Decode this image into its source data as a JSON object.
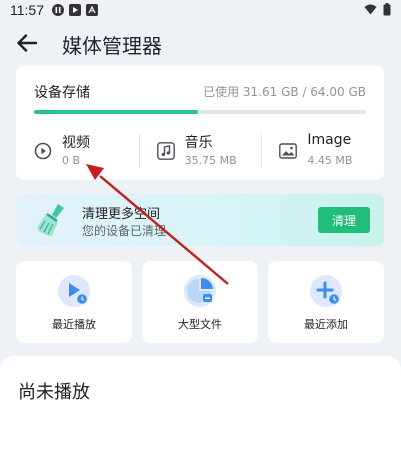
{
  "status_bar": {
    "time": "11:57",
    "icons": [
      "pause-icon",
      "play-store-icon",
      "a-badge-icon",
      "wifi-icon",
      "battery-icon"
    ]
  },
  "header": {
    "title": "媒体管理器",
    "back_icon": "arrow-back-icon"
  },
  "storage": {
    "title": "设备存储",
    "used_text": "已使用 31.61 GB / 64.00 GB",
    "used_fraction": 0.494,
    "categories": [
      {
        "label": "视频",
        "size": "0 B",
        "icon": "play-circle-icon"
      },
      {
        "label": "音乐",
        "size": "35.75 MB",
        "icon": "music-note-icon"
      },
      {
        "label": "Image",
        "size": "4.45 MB",
        "icon": "image-icon"
      }
    ]
  },
  "clean_banner": {
    "title": "清理更多空间",
    "subtitle": "您的设备已清理",
    "button": "清理",
    "icon": "broom-icon"
  },
  "tiles": [
    {
      "label": "最近播放",
      "icon": "recent-play-icon"
    },
    {
      "label": "大型文件",
      "icon": "pie-chart-icon"
    },
    {
      "label": "最近添加",
      "icon": "recent-add-icon"
    }
  ],
  "section": {
    "title": "尚未播放"
  },
  "colors": {
    "accent_green": "#27c485",
    "button_green": "#1fbf7a",
    "icon_blue": "#3b8ef0",
    "annotation_red": "#c81d1d"
  }
}
